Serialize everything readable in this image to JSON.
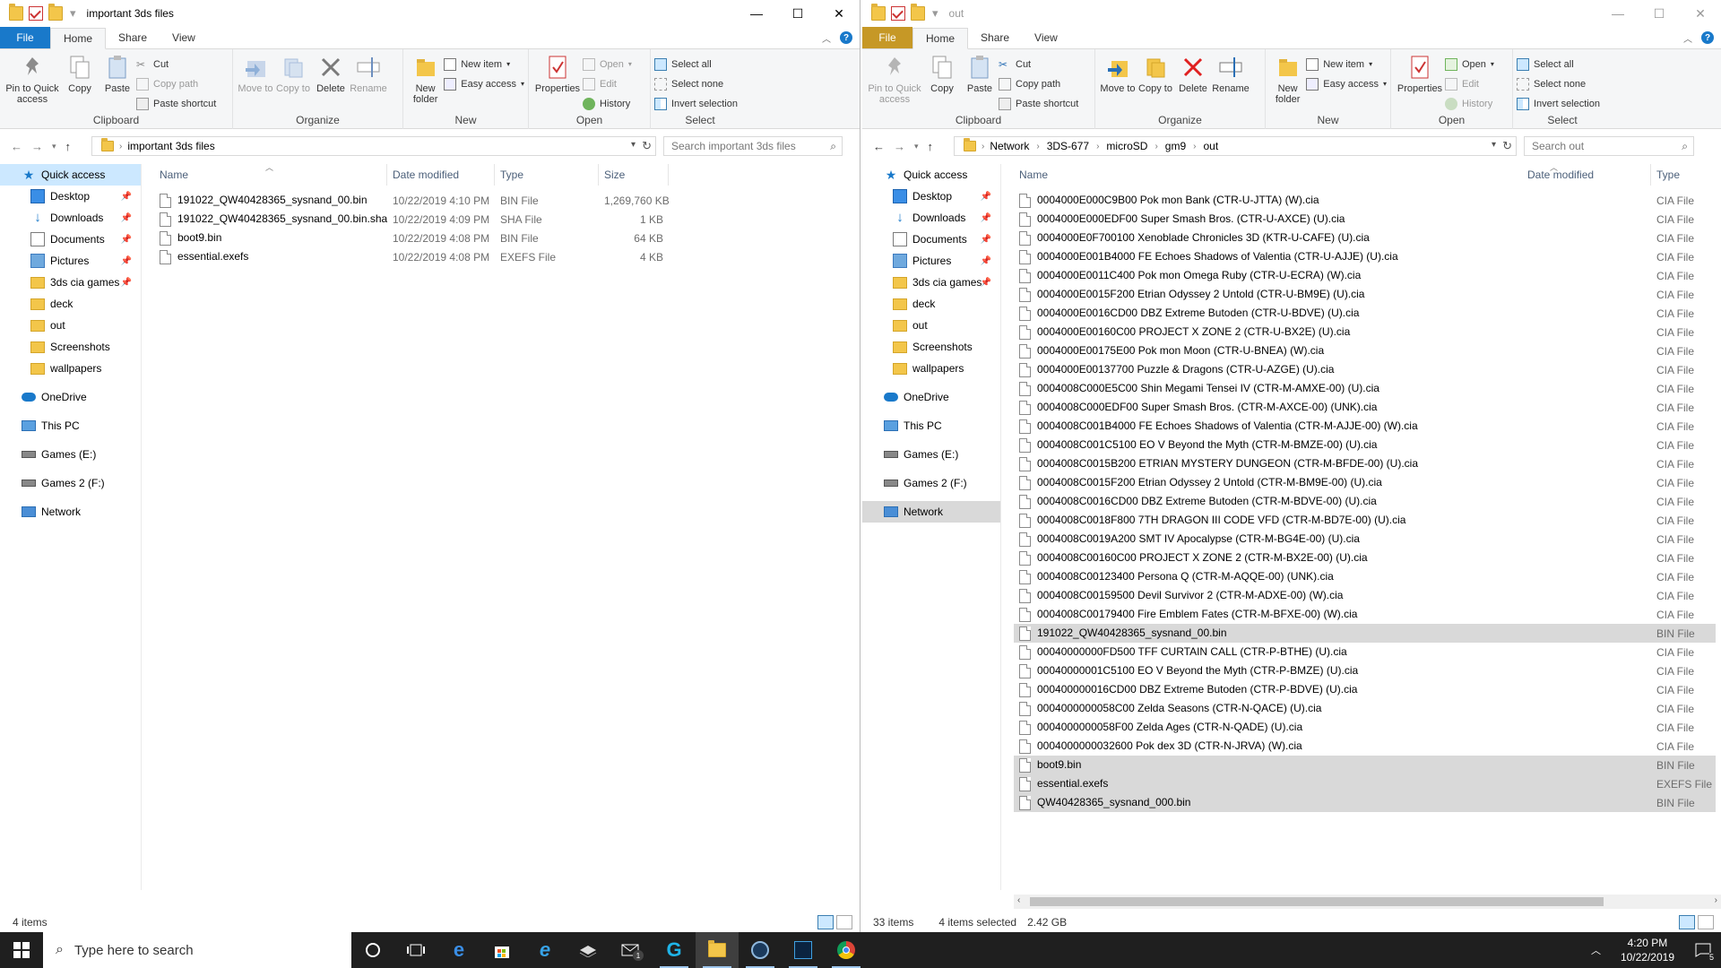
{
  "left": {
    "title": "important 3ds files",
    "tabs": {
      "file": "File",
      "home": "Home",
      "share": "Share",
      "view": "View"
    },
    "ribbon": {
      "clipboard": {
        "label": "Clipboard",
        "pin": "Pin to Quick access",
        "copy": "Copy",
        "paste": "Paste",
        "cut": "Cut",
        "copy_path": "Copy path",
        "paste_shortcut": "Paste shortcut"
      },
      "organize": {
        "label": "Organize",
        "move_to": "Move to",
        "copy_to": "Copy to",
        "delete": "Delete",
        "rename": "Rename"
      },
      "new": {
        "label": "New",
        "new_folder": "New folder",
        "new_item": "New item",
        "easy_access": "Easy access"
      },
      "open": {
        "label": "Open",
        "properties": "Properties",
        "open": "Open",
        "edit": "Edit",
        "history": "History"
      },
      "select": {
        "label": "Select",
        "select_all": "Select all",
        "select_none": "Select none",
        "invert": "Invert selection"
      }
    },
    "address": {
      "crumbs": [
        "important 3ds files"
      ]
    },
    "search_placeholder": "Search important 3ds files",
    "nav": [
      {
        "label": "Quick access",
        "icon": "star-icon",
        "level": 0,
        "pinned": false
      },
      {
        "label": "Desktop",
        "icon": "desktop-icon",
        "level": 1,
        "pinned": true
      },
      {
        "label": "Downloads",
        "icon": "download-icon",
        "level": 1,
        "pinned": true
      },
      {
        "label": "Documents",
        "icon": "documents-icon",
        "level": 1,
        "pinned": true
      },
      {
        "label": "Pictures",
        "icon": "pictures-icon",
        "level": 1,
        "pinned": true
      },
      {
        "label": "3ds cia games",
        "icon": "folder-icon",
        "level": 1,
        "pinned": true
      },
      {
        "label": "deck",
        "icon": "folder-icon",
        "level": 1,
        "pinned": false
      },
      {
        "label": "out",
        "icon": "folder-icon",
        "level": 1,
        "pinned": false
      },
      {
        "label": "Screenshots",
        "icon": "folder-icon",
        "level": 1,
        "pinned": false
      },
      {
        "label": "wallpapers",
        "icon": "folder-icon",
        "level": 1,
        "pinned": false
      },
      {
        "label": "OneDrive",
        "icon": "cloud-icon",
        "level": 0,
        "pinned": false
      },
      {
        "label": "This PC",
        "icon": "pc-icon",
        "level": 0,
        "pinned": false
      },
      {
        "label": "Games  (E:)",
        "icon": "drive-icon",
        "level": 0,
        "pinned": false
      },
      {
        "label": "Games 2 (F:)",
        "icon": "drive-icon",
        "level": 0,
        "pinned": false
      },
      {
        "label": "Network",
        "icon": "network-icon",
        "level": 0,
        "pinned": false
      }
    ],
    "columns": {
      "name": "Name",
      "date": "Date modified",
      "type": "Type",
      "size": "Size"
    },
    "files": [
      {
        "name": "191022_QW40428365_sysnand_00.bin",
        "date": "10/22/2019 4:10 PM",
        "type": "BIN File",
        "size": "1,269,760 KB"
      },
      {
        "name": "191022_QW40428365_sysnand_00.bin.sha",
        "date": "10/22/2019 4:09 PM",
        "type": "SHA File",
        "size": "1 KB"
      },
      {
        "name": "boot9.bin",
        "date": "10/22/2019 4:08 PM",
        "type": "BIN File",
        "size": "64 KB"
      },
      {
        "name": "essential.exefs",
        "date": "10/22/2019 4:08 PM",
        "type": "EXEFS File",
        "size": "4 KB"
      }
    ],
    "status": {
      "count": "4 items"
    }
  },
  "right": {
    "title": "out",
    "tabs": {
      "file": "File",
      "home": "Home",
      "share": "Share",
      "view": "View"
    },
    "ribbon": {
      "clipboard": {
        "label": "Clipboard",
        "pin": "Pin to Quick access",
        "copy": "Copy",
        "paste": "Paste",
        "cut": "Cut",
        "copy_path": "Copy path",
        "paste_shortcut": "Paste shortcut"
      },
      "organize": {
        "label": "Organize",
        "move_to": "Move to",
        "copy_to": "Copy to",
        "delete": "Delete",
        "rename": "Rename"
      },
      "new": {
        "label": "New",
        "new_folder": "New folder",
        "new_item": "New item",
        "easy_access": "Easy access"
      },
      "open": {
        "label": "Open",
        "properties": "Properties",
        "open": "Open",
        "edit": "Edit",
        "history": "History"
      },
      "select": {
        "label": "Select",
        "select_all": "Select all",
        "select_none": "Select none",
        "invert": "Invert selection"
      }
    },
    "address": {
      "crumbs": [
        "Network",
        "3DS-677",
        "microSD",
        "gm9",
        "out"
      ]
    },
    "search_placeholder": "Search out",
    "nav": [
      {
        "label": "Quick access",
        "icon": "star-icon",
        "level": 0,
        "pinned": false
      },
      {
        "label": "Desktop",
        "icon": "desktop-icon",
        "level": 1,
        "pinned": true
      },
      {
        "label": "Downloads",
        "icon": "download-icon",
        "level": 1,
        "pinned": true
      },
      {
        "label": "Documents",
        "icon": "documents-icon",
        "level": 1,
        "pinned": true
      },
      {
        "label": "Pictures",
        "icon": "pictures-icon",
        "level": 1,
        "pinned": true
      },
      {
        "label": "3ds cia games",
        "icon": "folder-icon",
        "level": 1,
        "pinned": true
      },
      {
        "label": "deck",
        "icon": "folder-icon",
        "level": 1,
        "pinned": false
      },
      {
        "label": "out",
        "icon": "folder-icon",
        "level": 1,
        "pinned": false
      },
      {
        "label": "Screenshots",
        "icon": "folder-icon",
        "level": 1,
        "pinned": false
      },
      {
        "label": "wallpapers",
        "icon": "folder-icon",
        "level": 1,
        "pinned": false
      },
      {
        "label": "OneDrive",
        "icon": "cloud-icon",
        "level": 0,
        "pinned": false
      },
      {
        "label": "This PC",
        "icon": "pc-icon",
        "level": 0,
        "pinned": false
      },
      {
        "label": "Games  (E:)",
        "icon": "drive-icon",
        "level": 0,
        "pinned": false
      },
      {
        "label": "Games 2 (F:)",
        "icon": "drive-icon",
        "level": 0,
        "pinned": false
      },
      {
        "label": "Network",
        "icon": "network-icon",
        "level": 0,
        "pinned": false,
        "selected": true
      }
    ],
    "columns": {
      "name": "Name",
      "date": "Date modified",
      "type": "Type"
    },
    "files": [
      {
        "name": "0004000E000C9B00 Pok mon Bank (CTR-U-JTTA) (W).cia",
        "type": "CIA File"
      },
      {
        "name": "0004000E000EDF00 Super Smash Bros. (CTR-U-AXCE) (U).cia",
        "type": "CIA File"
      },
      {
        "name": "0004000E0F700100 Xenoblade Chronicles 3D (KTR-U-CAFE) (U).cia",
        "type": "CIA File"
      },
      {
        "name": "0004000E001B4000 FE Echoes Shadows of Valentia (CTR-U-AJJE) (U).cia",
        "type": "CIA File"
      },
      {
        "name": "0004000E0011C400 Pok mon Omega Ruby (CTR-U-ECRA) (W).cia",
        "type": "CIA File"
      },
      {
        "name": "0004000E0015F200 Etrian Odyssey 2 Untold (CTR-U-BM9E) (U).cia",
        "type": "CIA File"
      },
      {
        "name": "0004000E0016CD00 DBZ Extreme Butoden (CTR-U-BDVE) (U).cia",
        "type": "CIA File"
      },
      {
        "name": "0004000E00160C00 PROJECT X ZONE 2 (CTR-U-BX2E) (U).cia",
        "type": "CIA File"
      },
      {
        "name": "0004000E00175E00 Pok mon Moon (CTR-U-BNEA) (W).cia",
        "type": "CIA File"
      },
      {
        "name": "0004000E00137700 Puzzle & Dragons (CTR-U-AZGE) (U).cia",
        "type": "CIA File"
      },
      {
        "name": "0004008C000E5C00 Shin Megami Tensei IV (CTR-M-AMXE-00) (U).cia",
        "type": "CIA File"
      },
      {
        "name": "0004008C000EDF00 Super Smash Bros. (CTR-M-AXCE-00) (UNK).cia",
        "type": "CIA File"
      },
      {
        "name": "0004008C001B4000 FE Echoes Shadows of Valentia (CTR-M-AJJE-00) (W).cia",
        "type": "CIA File"
      },
      {
        "name": "0004008C001C5100 EO V Beyond the Myth (CTR-M-BMZE-00) (U).cia",
        "type": "CIA File"
      },
      {
        "name": "0004008C0015B200 ETRIAN MYSTERY DUNGEON (CTR-M-BFDE-00) (U).cia",
        "type": "CIA File"
      },
      {
        "name": "0004008C0015F200 Etrian Odyssey 2 Untold (CTR-M-BM9E-00) (U).cia",
        "type": "CIA File"
      },
      {
        "name": "0004008C0016CD00 DBZ Extreme Butoden (CTR-M-BDVE-00) (U).cia",
        "type": "CIA File"
      },
      {
        "name": "0004008C0018F800 7TH DRAGON III CODE VFD (CTR-M-BD7E-00) (U).cia",
        "type": "CIA File"
      },
      {
        "name": "0004008C0019A200 SMT IV Apocalypse (CTR-M-BG4E-00) (U).cia",
        "type": "CIA File"
      },
      {
        "name": "0004008C00160C00 PROJECT X ZONE 2 (CTR-M-BX2E-00) (U).cia",
        "type": "CIA File"
      },
      {
        "name": "0004008C00123400 Persona Q (CTR-M-AQQE-00) (UNK).cia",
        "type": "CIA File"
      },
      {
        "name": "0004008C00159500 Devil Survivor 2 (CTR-M-ADXE-00) (W).cia",
        "type": "CIA File"
      },
      {
        "name": "0004008C00179400 Fire Emblem Fates (CTR-M-BFXE-00) (W).cia",
        "type": "CIA File"
      },
      {
        "name": "191022_QW40428365_sysnand_00.bin",
        "type": "BIN File",
        "selected": true
      },
      {
        "name": "00040000000FD500 TFF CURTAIN CALL (CTR-P-BTHE) (U).cia",
        "type": "CIA File"
      },
      {
        "name": "00040000001C5100 EO V Beyond the Myth (CTR-P-BMZE) (U).cia",
        "type": "CIA File"
      },
      {
        "name": "000400000016CD00 DBZ Extreme Butoden (CTR-P-BDVE) (U).cia",
        "type": "CIA File"
      },
      {
        "name": "0004000000058C00 Zelda Seasons (CTR-N-QACE) (U).cia",
        "type": "CIA File"
      },
      {
        "name": "0004000000058F00 Zelda Ages (CTR-N-QADE) (U).cia",
        "type": "CIA File"
      },
      {
        "name": "0004000000032600 Pok dex 3D (CTR-N-JRVA) (W).cia",
        "type": "CIA File"
      },
      {
        "name": "boot9.bin",
        "type": "BIN File",
        "selected": true
      },
      {
        "name": "essential.exefs",
        "type": "EXEFS File",
        "selected": true
      },
      {
        "name": "QW40428365_sysnand_000.bin",
        "type": "BIN File",
        "selected": true
      }
    ],
    "status": {
      "count": "33 items",
      "selected": "4 items selected",
      "size": "2.42 GB"
    }
  },
  "taskbar": {
    "search_placeholder": "Type here to search",
    "time": "4:20 PM",
    "date": "10/22/2019",
    "notif_count": "5",
    "mail_badge": "1"
  },
  "colors": {
    "file_tab_active": "#1979ca",
    "file_tab_inactive": "#c69826",
    "selection": "#d9d9d9",
    "nav_hover": "#cce8ff",
    "taskbar": "#1f1f1f"
  }
}
